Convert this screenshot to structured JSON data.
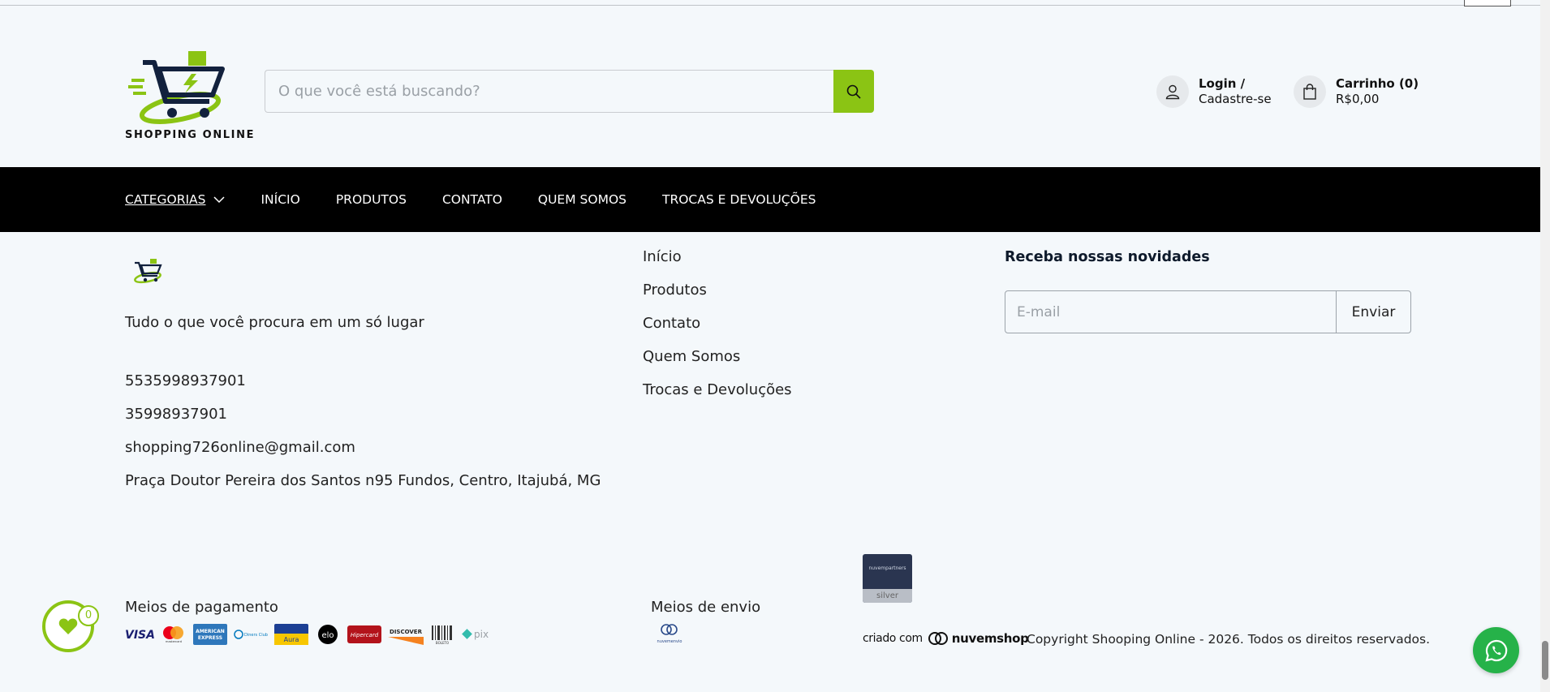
{
  "header": {
    "logo_text": "SHOPPING ONLINE",
    "search_placeholder": "O que você está buscando?",
    "account_line1": "Login /",
    "account_line2": "Cadastre-se",
    "cart_line1": "Carrinho (0)",
    "cart_line2": "R$0,00"
  },
  "nav": {
    "items": [
      "CATEGORIAS",
      "INÍCIO",
      "PRODUTOS",
      "CONTATO",
      "QUEM SOMOS",
      "TROCAS E DEVOLUÇÕES"
    ]
  },
  "footer": {
    "tagline": "Tudo o que você procura em um só lugar",
    "phone1": "5535998937901",
    "phone2": "35998937901",
    "email": "shopping726online@gmail.com",
    "address": "Praça Doutor Pereira dos Santos n95 Fundos, Centro, Itajubá, MG",
    "links": [
      "Início",
      "Produtos",
      "Contato",
      "Quem Somos",
      "Trocas e Devoluções"
    ],
    "newsletter_title": "Receba nossas novidades",
    "newsletter_placeholder": "E-mail",
    "newsletter_button": "Enviar",
    "payment_title": "Meios de pagamento",
    "payment_methods": [
      "VISA",
      "mastercard",
      "AMERICAN EXPRESS",
      "Diners Club",
      "Aura",
      "elo",
      "Hipercard",
      "DISCOVER",
      "BOLETO",
      "pix"
    ],
    "shipping_title": "Meios de envio",
    "shipping_label": "nuvemenvio",
    "partner_top": "nuvempartners",
    "partner_bottom": "silver",
    "made_by_label": "criado com",
    "made_by_brand": "nuvemshop",
    "copyright": "Copyright Shooping Online - 2026. Todos os direitos reservados."
  },
  "wishlist": {
    "count": "0"
  },
  "colors": {
    "accent": "#8bc414",
    "nav_bg": "#000000",
    "page_bg": "#f4f8fb",
    "whatsapp": "#26b249"
  }
}
